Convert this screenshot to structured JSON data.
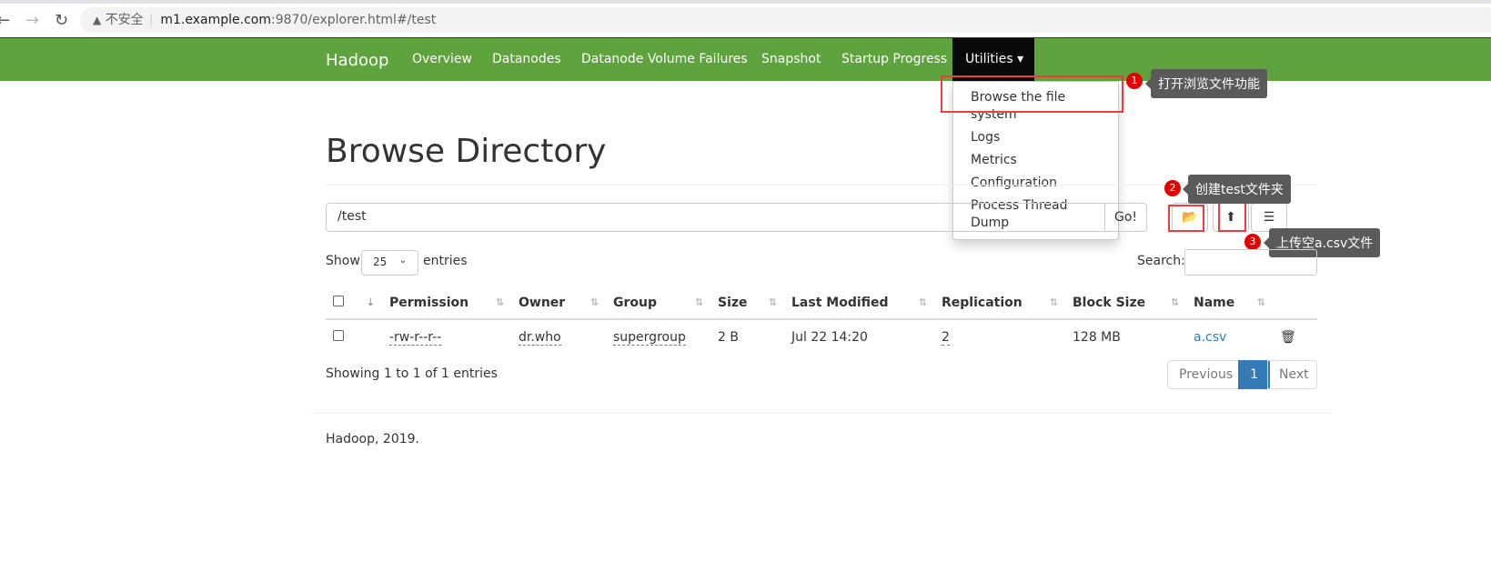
{
  "browser": {
    "security_label": "不安全",
    "url_host": "m1.example.com",
    "url_rest": ":9870/explorer.html#/test"
  },
  "navbar": {
    "brand": "Hadoop",
    "items": [
      "Overview",
      "Datanodes",
      "Datanode Volume Failures",
      "Snapshot",
      "Startup Progress"
    ],
    "utilities": "Utilities ▾",
    "color": "#5fa33e"
  },
  "dropdown": [
    "Browse the file system",
    "Logs",
    "Metrics",
    "Configuration",
    "Process Thread Dump"
  ],
  "annotations": [
    {
      "num": "1",
      "text": "打开浏览文件功能"
    },
    {
      "num": "2",
      "text": "创建test文件夹"
    },
    {
      "num": "3",
      "text": "上传空a.csv文件"
    }
  ],
  "main": {
    "title": "Browse Directory",
    "path": "/test",
    "go": "Go!",
    "show": "Show",
    "entries_value": "25",
    "entries": "entries",
    "search": "Search:"
  },
  "table": {
    "headers": [
      "Permission",
      "Owner",
      "Group",
      "Size",
      "Last Modified",
      "Replication",
      "Block Size",
      "Name"
    ],
    "rows": [
      {
        "permission": "-rw-r--r--",
        "owner": "dr.who",
        "group": "supergroup",
        "size": "2 B",
        "modified": "Jul 22 14:20",
        "replication": "2",
        "block_size": "128 MB",
        "name": "a.csv"
      }
    ]
  },
  "pagination": {
    "info": "Showing 1 to 1 of 1 entries",
    "previous": "Previous",
    "page": "1",
    "next": "Next"
  },
  "footer": "Hadoop, 2019."
}
